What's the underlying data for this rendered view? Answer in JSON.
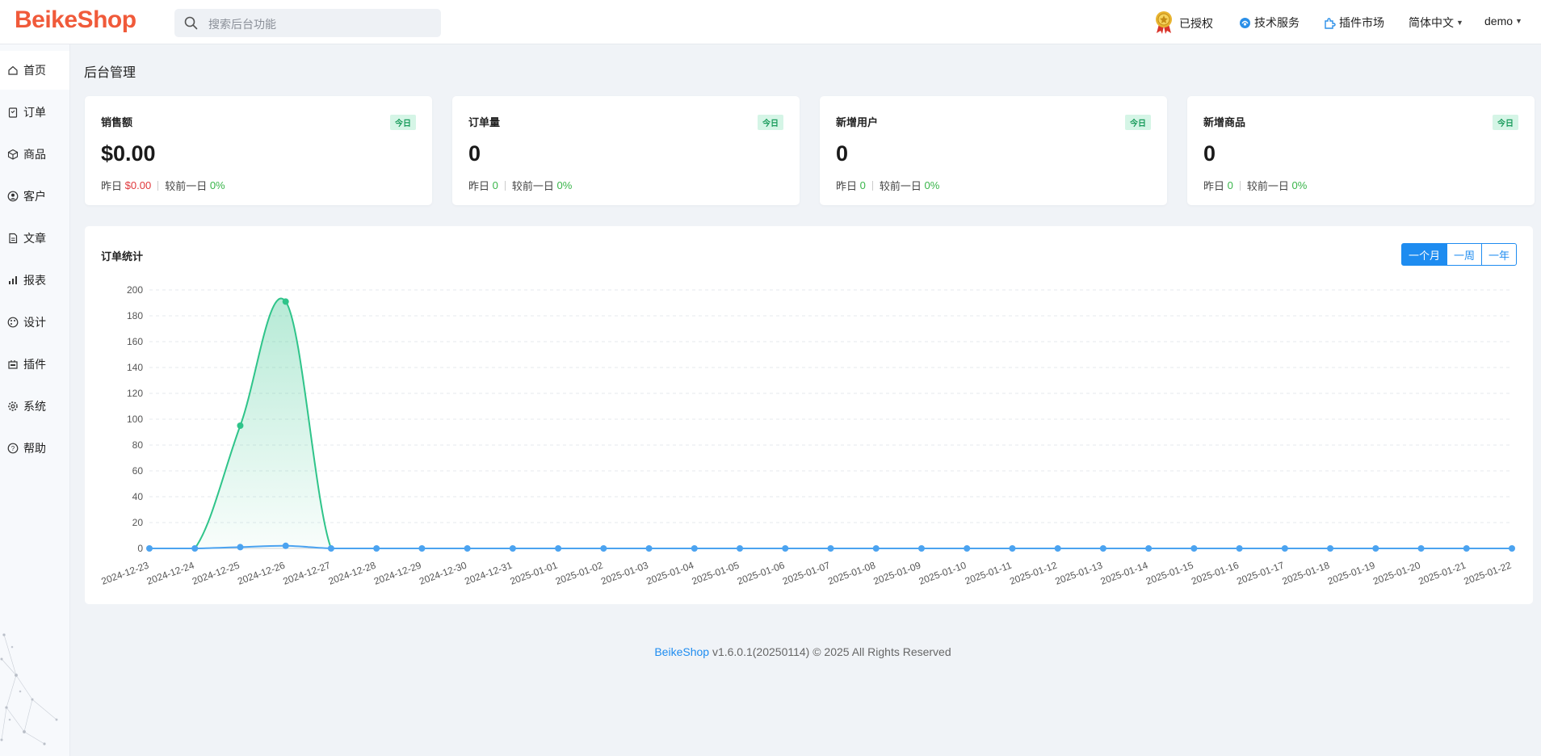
{
  "header": {
    "logo": "BeikeShop",
    "search_placeholder": "搜索后台功能",
    "authorized": "已授权",
    "tech_service": "技术服务",
    "plugin_market": "插件市场",
    "language": "简体中文",
    "user": "demo"
  },
  "sidebar": {
    "items": [
      {
        "label": "首页",
        "icon": "home-icon"
      },
      {
        "label": "订单",
        "icon": "order-icon"
      },
      {
        "label": "商品",
        "icon": "box-icon"
      },
      {
        "label": "客户",
        "icon": "user-icon"
      },
      {
        "label": "文章",
        "icon": "document-icon"
      },
      {
        "label": "报表",
        "icon": "bar-chart-icon"
      },
      {
        "label": "设计",
        "icon": "palette-icon"
      },
      {
        "label": "插件",
        "icon": "plugin-icon"
      },
      {
        "label": "系统",
        "icon": "gear-icon"
      },
      {
        "label": "帮助",
        "icon": "help-icon"
      }
    ]
  },
  "main": {
    "title": "后台管理",
    "cards": [
      {
        "title": "销售额",
        "badge": "今日",
        "value": "$0.00",
        "yesterday_label": "昨日",
        "yesterday_value": "$0.00",
        "compare_label": "较前一日",
        "compare_value": "0%"
      },
      {
        "title": "订单量",
        "badge": "今日",
        "value": "0",
        "yesterday_label": "昨日",
        "yesterday_value": "0",
        "compare_label": "较前一日",
        "compare_value": "0%"
      },
      {
        "title": "新增用户",
        "badge": "今日",
        "value": "0",
        "yesterday_label": "昨日",
        "yesterday_value": "0",
        "compare_label": "较前一日",
        "compare_value": "0%"
      },
      {
        "title": "新增商品",
        "badge": "今日",
        "value": "0",
        "yesterday_label": "昨日",
        "yesterday_value": "0",
        "compare_label": "较前一日",
        "compare_value": "0%"
      }
    ],
    "chart_title": "订单统计",
    "ranges": [
      "一个月",
      "一周",
      "一年"
    ]
  },
  "footer": {
    "brand": "BeikeShop",
    "text": " v1.6.0.1(20250114) © 2025 All Rights Reserved"
  },
  "colors": {
    "accent": "#1e8cf0",
    "brand": "#f05a3a",
    "green_series": "#2fc48a",
    "blue_series": "#4ba3f0"
  },
  "chart_data": {
    "type": "line",
    "x": [
      "2024-12-23",
      "2024-12-24",
      "2024-12-25",
      "2024-12-26",
      "2024-12-27",
      "2024-12-28",
      "2024-12-29",
      "2024-12-30",
      "2024-12-31",
      "2025-01-01",
      "2025-01-02",
      "2025-01-03",
      "2025-01-04",
      "2025-01-05",
      "2025-01-06",
      "2025-01-07",
      "2025-01-08",
      "2025-01-09",
      "2025-01-10",
      "2025-01-11",
      "2025-01-12",
      "2025-01-13",
      "2025-01-14",
      "2025-01-15",
      "2025-01-16",
      "2025-01-17",
      "2025-01-18",
      "2025-01-19",
      "2025-01-20",
      "2025-01-21",
      "2025-01-22"
    ],
    "series": [
      {
        "values": [
          0,
          0,
          95,
          191,
          0,
          0,
          0,
          0,
          0,
          0,
          0,
          0,
          0,
          0,
          0,
          0,
          0,
          0,
          0,
          0,
          0,
          0,
          0,
          0,
          0,
          0,
          0,
          0,
          0,
          0,
          0
        ],
        "area": true
      },
      {
        "values": [
          0,
          0,
          1,
          2,
          0,
          0,
          0,
          0,
          0,
          0,
          0,
          0,
          0,
          0,
          0,
          0,
          0,
          0,
          0,
          0,
          0,
          0,
          0,
          0,
          0,
          0,
          0,
          0,
          0,
          0,
          0
        ],
        "area": false
      }
    ],
    "ylim": [
      0,
      200
    ],
    "yticks": [
      0,
      20,
      40,
      60,
      80,
      100,
      120,
      140,
      160,
      180,
      200
    ],
    "grid": true
  }
}
